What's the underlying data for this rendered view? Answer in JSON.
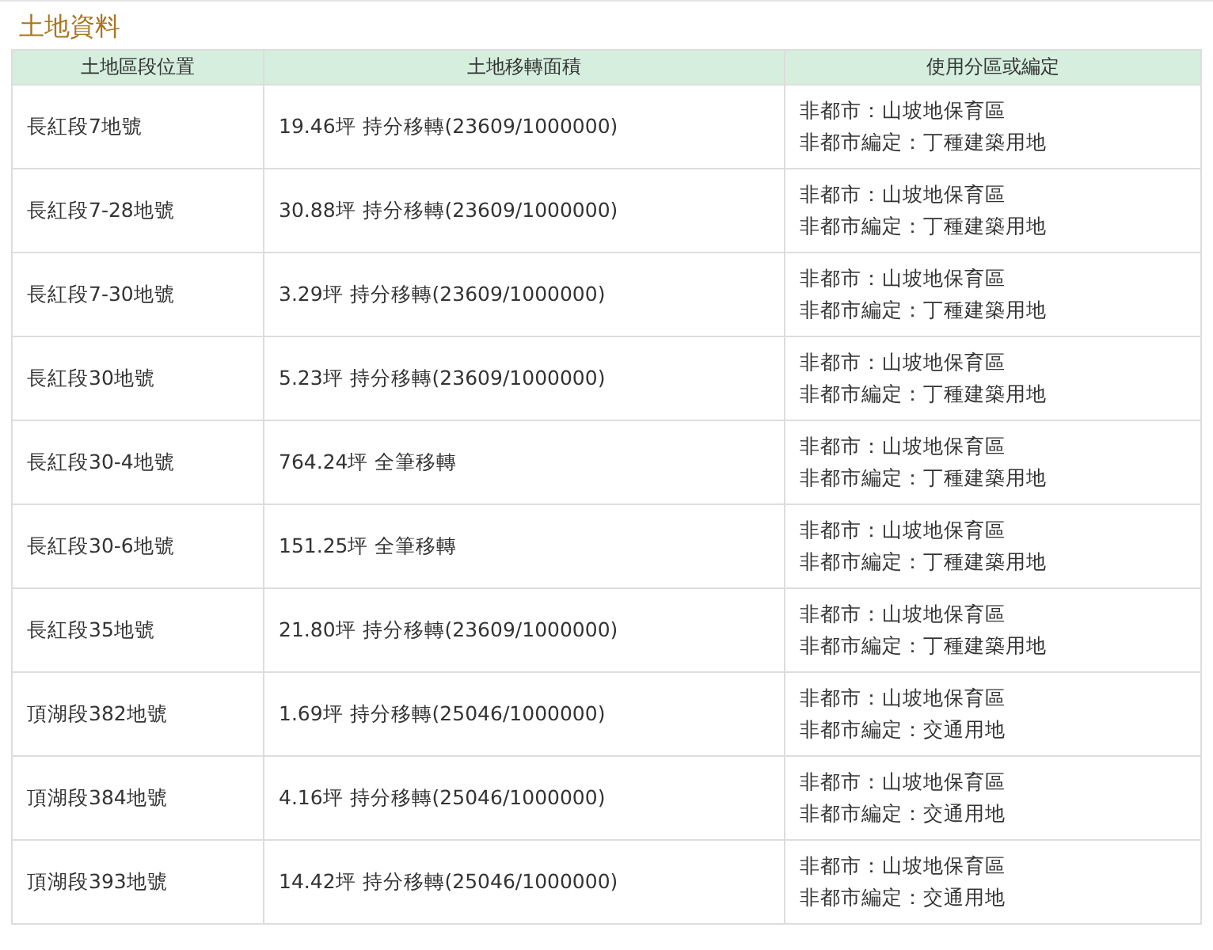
{
  "title": "土地資料",
  "table": {
    "columns": [
      "土地區段位置",
      "土地移轉面積",
      "使用分區或編定"
    ],
    "rows": [
      {
        "location": "長紅段7地號",
        "area": "19.46坪 持分移轉(23609/1000000)",
        "zoning": [
          "非都市：山坡地保育區",
          "非都市編定：丁種建築用地"
        ]
      },
      {
        "location": "長紅段7-28地號",
        "area": "30.88坪 持分移轉(23609/1000000)",
        "zoning": [
          "非都市：山坡地保育區",
          "非都市編定：丁種建築用地"
        ]
      },
      {
        "location": "長紅段7-30地號",
        "area": "3.29坪 持分移轉(23609/1000000)",
        "zoning": [
          "非都市：山坡地保育區",
          "非都市編定：丁種建築用地"
        ]
      },
      {
        "location": "長紅段30地號",
        "area": "5.23坪 持分移轉(23609/1000000)",
        "zoning": [
          "非都市：山坡地保育區",
          "非都市編定：丁種建築用地"
        ]
      },
      {
        "location": "長紅段30-4地號",
        "area": "764.24坪 全筆移轉",
        "zoning": [
          "非都市：山坡地保育區",
          "非都市編定：丁種建築用地"
        ]
      },
      {
        "location": "長紅段30-6地號",
        "area": "151.25坪 全筆移轉",
        "zoning": [
          "非都市：山坡地保育區",
          "非都市編定：丁種建築用地"
        ]
      },
      {
        "location": "長紅段35地號",
        "area": "21.80坪 持分移轉(23609/1000000)",
        "zoning": [
          "非都市：山坡地保育區",
          "非都市編定：丁種建築用地"
        ]
      },
      {
        "location": "頂湖段382地號",
        "area": "1.69坪 持分移轉(25046/1000000)",
        "zoning": [
          "非都市：山坡地保育區",
          "非都市編定：交通用地"
        ]
      },
      {
        "location": "頂湖段384地號",
        "area": "4.16坪 持分移轉(25046/1000000)",
        "zoning": [
          "非都市：山坡地保育區",
          "非都市編定：交通用地"
        ]
      },
      {
        "location": "頂湖段393地號",
        "area": "14.42坪 持分移轉(25046/1000000)",
        "zoning": [
          "非都市：山坡地保育區",
          "非都市編定：交通用地"
        ]
      }
    ]
  }
}
